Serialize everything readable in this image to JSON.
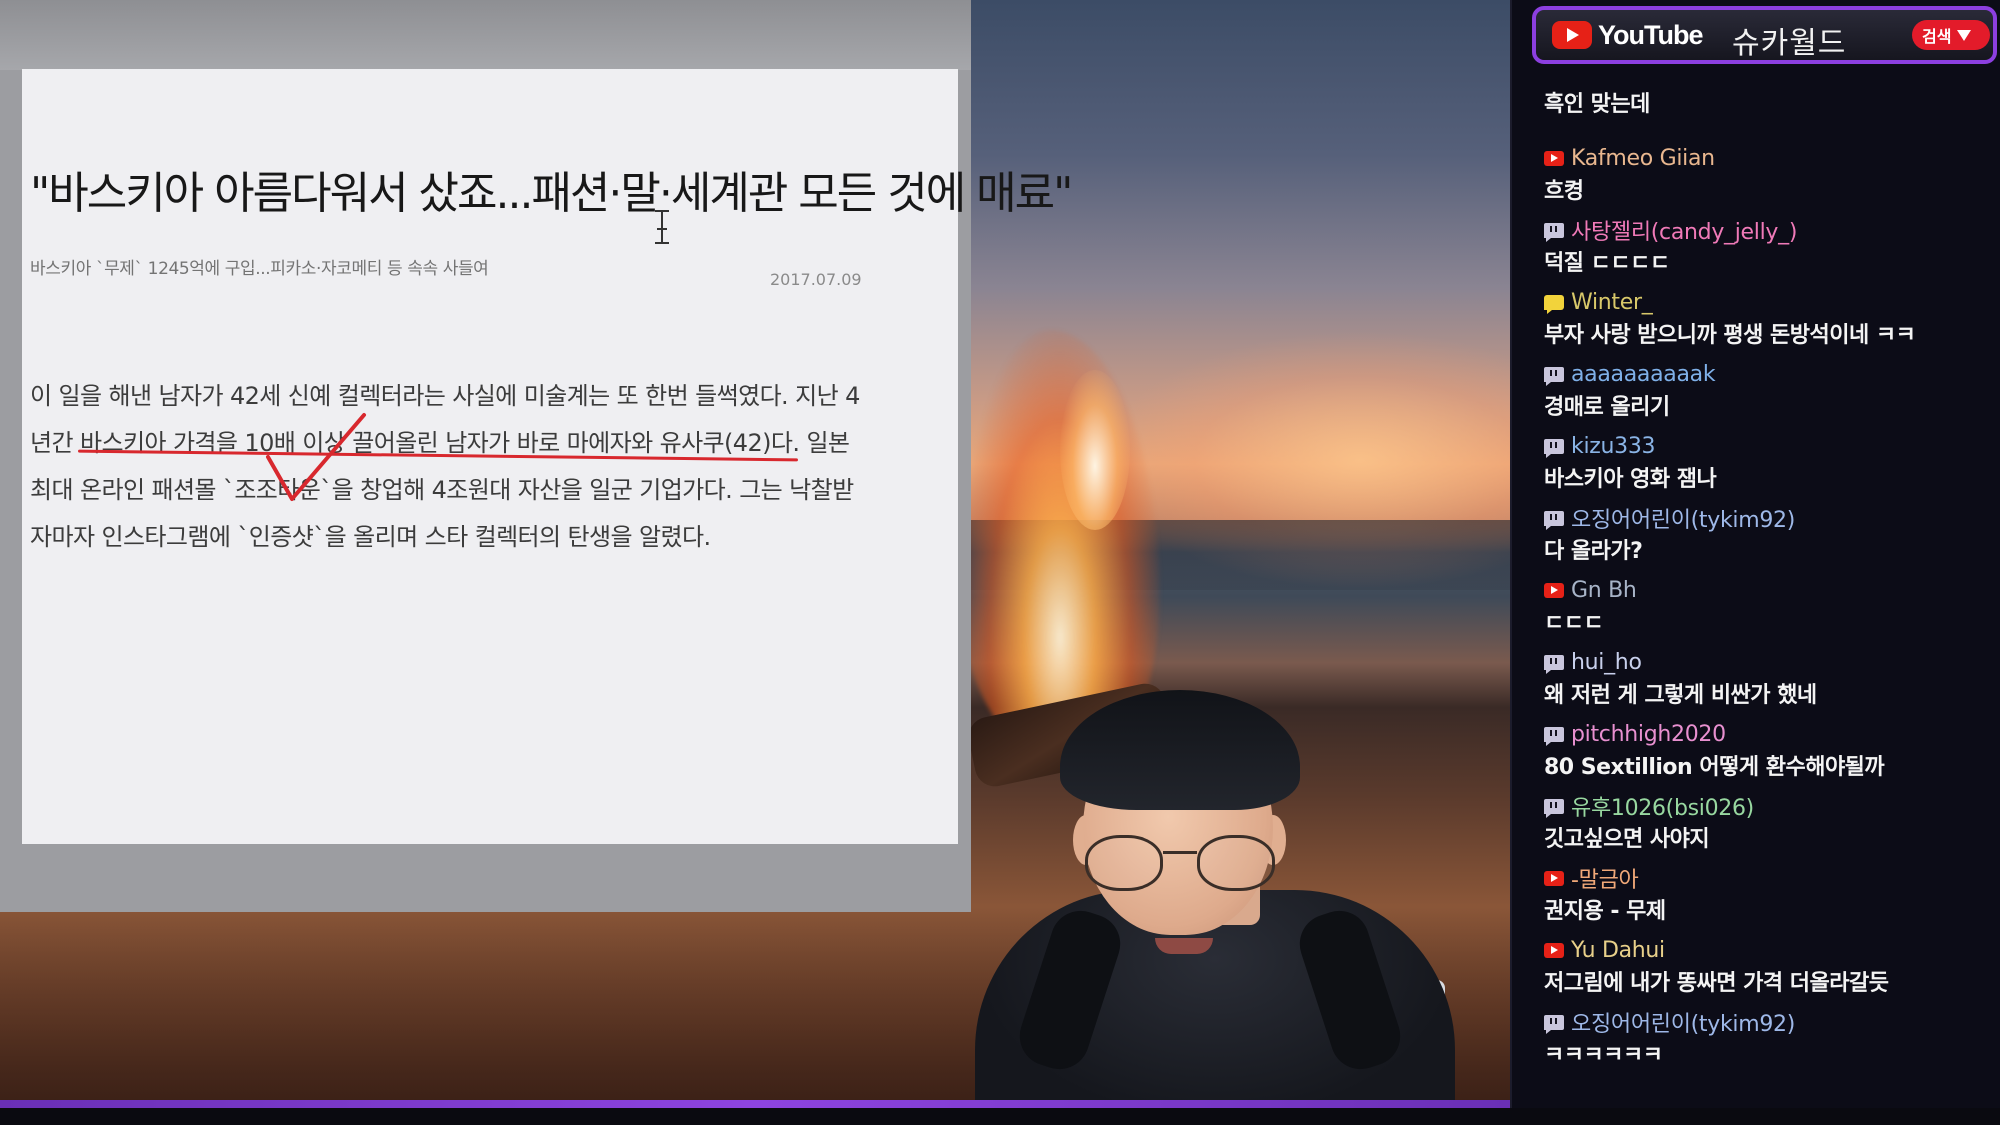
{
  "article": {
    "headline": "\"바스키아 아름다워서 샀죠...패션·말·세계관 모든 것에 매료\"",
    "subline": "바스키아 `무제` 1245억에 구입...피카소·자코메티 등 속속 사들여",
    "date": "2017.07.09",
    "body_lines": [
      "이 일을 해낸 남자가 42세 신예 컬렉터라는 사실에 미술계는 또 한번 들썩였다. 지난 4",
      "년간 바스키아 가격을 10배 이상 끌어올린 남자가 바로 마에자와 유사쿠(42)다. 일본",
      "최대 온라인 패션몰 `조조타운`을 창업해 4조원대 자산을 일군 기업가다. 그는 낙찰받",
      "자마자 인스타그램에 `인증샷`을 올리며 스타 컬렉터의 탄생을 알렸다."
    ],
    "annotation_color": "#d8282e"
  },
  "header": {
    "platform": "YouTube",
    "channel": "슈카월드",
    "search_label": "검색",
    "accent_color": "#8c3fe0"
  },
  "chat": {
    "partial_top": "...",
    "messages": [
      {
        "platform": "none",
        "user": "",
        "user_color": "#c8c8c8",
        "text": "흑인 맞는데"
      },
      {
        "platform": "youtube",
        "user": "Kafmeo Giian",
        "user_color": "#e9b78f",
        "text": "흐켱"
      },
      {
        "platform": "twitch",
        "user": "사탕젤리(candy_jelly_)",
        "user_color": "#f07ab8",
        "text": "덕질 ㄷㄷㄷㄷ"
      },
      {
        "platform": "kakao",
        "user": "Winter_",
        "user_color": "#d8c86a",
        "text": "부자 사랑 받으니까 평생 돈방석이네 ㅋㅋ"
      },
      {
        "platform": "twitch",
        "user": "aaaaaaaaaak",
        "user_color": "#7fb0e8",
        "text": "경매로 올리기"
      },
      {
        "platform": "twitch",
        "user": "kizu333",
        "user_color": "#8ab4e6",
        "text": "바스키아 영화 잼나"
      },
      {
        "platform": "twitch",
        "user": "오징어어린이(tykim92)",
        "user_color": "#9eb8e8",
        "text": "다 올라가?"
      },
      {
        "platform": "youtube",
        "user": "Gn Bh",
        "user_color": "#a8b4c8",
        "text": "ㄷㄷㄷ"
      },
      {
        "platform": "twitch",
        "user": "hui_ho",
        "user_color": "#c8d0ec",
        "text": "왜 저런 게 그렇게 비싼가 했네"
      },
      {
        "platform": "twitch",
        "user": "pitchhigh2020",
        "user_color": "#e890d0",
        "text": "80 Sextillion 어떻게 환수해야될까"
      },
      {
        "platform": "twitch",
        "user": "유후1026(bsi026)",
        "user_color": "#98d8a0",
        "text": "깃고싶으면 사야지"
      },
      {
        "platform": "youtube",
        "user": "-말금아",
        "user_color": "#f0a878",
        "text": "권지용 - 무제"
      },
      {
        "platform": "youtube",
        "user": "Yu Dahui",
        "user_color": "#e8d08a",
        "text": "저그림에 내가 똥싸면 가격 더올라갈듯"
      },
      {
        "platform": "twitch",
        "user": "오징어어린이(tykim92)",
        "user_color": "#9eb8e8",
        "text": "ㅋㅋㅋㅋㅋㅋ"
      }
    ]
  }
}
